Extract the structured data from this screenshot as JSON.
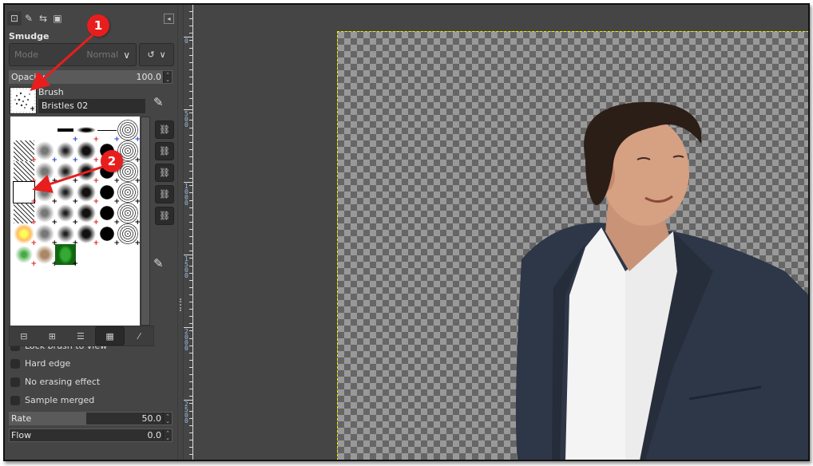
{
  "dock": {
    "tabs": [
      {
        "icon": "tool-options-icon",
        "glyph": "⊡",
        "active": true
      },
      {
        "icon": "device-status-icon",
        "glyph": "✎"
      },
      {
        "icon": "undo-history-icon",
        "glyph": "⇆"
      },
      {
        "icon": "images-icon",
        "glyph": "▣"
      }
    ],
    "menu_glyph": "◂",
    "tool_title": "Smudge",
    "mode": {
      "label": "Mode",
      "value": "Normal"
    },
    "mode_extra_glyph": "↺",
    "chevron": "∨",
    "opacity": {
      "label": "Opacity",
      "value": "100.0",
      "fraction": 1.0
    },
    "brush": {
      "label": "Brush",
      "name": "Bristles 02"
    },
    "edit_glyph": "✎",
    "brush_count": 37,
    "side_button_glyph": "⛓",
    "grid_buttons": [
      {
        "name": "shrink-button",
        "glyph": "⊟"
      },
      {
        "name": "enlarge-button",
        "glyph": "⊞"
      },
      {
        "name": "view-as-list-button",
        "glyph": "☰"
      },
      {
        "name": "view-as-grid-button",
        "glyph": "▦",
        "active": true
      },
      {
        "name": "edit-brush-button",
        "glyph": "⁄"
      }
    ],
    "checks": [
      {
        "label": "Lock brush to view"
      },
      {
        "label": "Hard edge"
      },
      {
        "label": "No erasing effect"
      },
      {
        "label": "Sample merged"
      }
    ],
    "rate": {
      "label": "Rate",
      "value": "50.0",
      "fraction": 0.5
    },
    "flow": {
      "label": "Flow",
      "value": "0.0",
      "fraction": 0.0
    }
  },
  "ruler": {
    "labels": [
      "0",
      "500",
      "1000",
      "1500",
      "2000",
      "2500"
    ]
  },
  "annotations": [
    {
      "number": "1",
      "color": "#e81e1e"
    },
    {
      "number": "2",
      "color": "#e81e1e"
    }
  ],
  "canvas": {
    "subject": "man in dark blazer and white shirt on transparent background"
  }
}
